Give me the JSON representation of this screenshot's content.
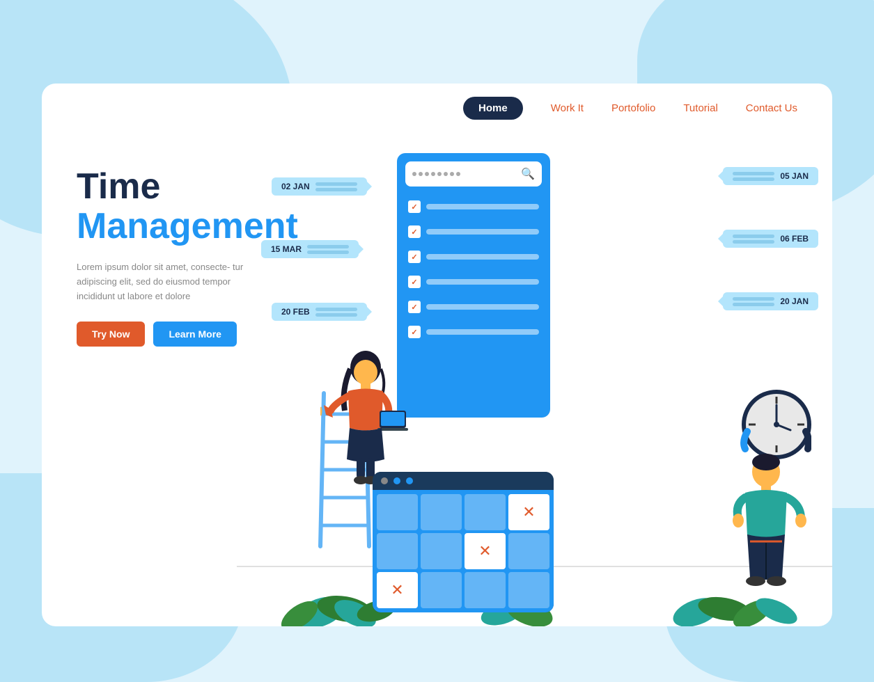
{
  "page": {
    "title": "Time Management"
  },
  "navbar": {
    "items": [
      {
        "label": "Home",
        "active": true
      },
      {
        "label": "Work It",
        "active": false
      },
      {
        "label": "Portofolio",
        "active": false
      },
      {
        "label": "Tutorial",
        "active": false
      },
      {
        "label": "Contact Us",
        "active": false
      }
    ]
  },
  "hero": {
    "title_line1": "Time",
    "title_line2": "Management",
    "description": "Lorem ipsum dolor sit amet, consecte-\ntur adipiscing elit, sed do eiusmod\ntempor incididunt ut labore et dolore",
    "btn_try": "Try Now",
    "btn_learn": "Learn More"
  },
  "dates_left": [
    {
      "label": "02 JAN"
    },
    {
      "label": "15 MAR"
    },
    {
      "label": "20 FEB"
    }
  ],
  "dates_right": [
    {
      "label": "05 JAN"
    },
    {
      "label": "06 FEB"
    },
    {
      "label": "20 JAN"
    }
  ],
  "colors": {
    "primary": "#2196f3",
    "dark_navy": "#1a2b4a",
    "orange": "#e05a2b",
    "light_blue": "#b3e5fc"
  }
}
